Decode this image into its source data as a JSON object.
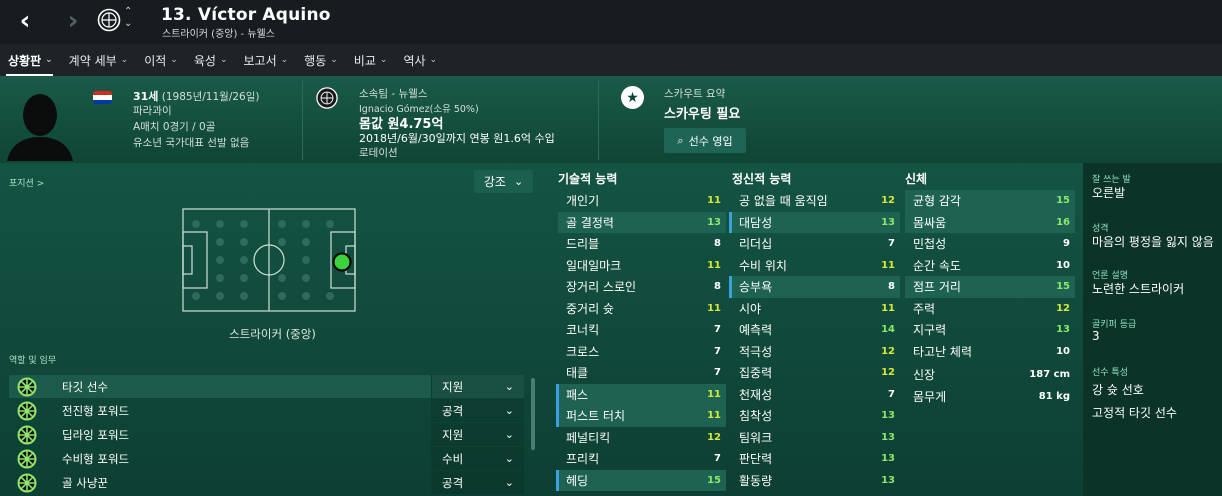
{
  "header": {
    "player_name": "13. Víctor Aquino",
    "player_subtitle": "스트라이커 (중앙) - 뉴웰스",
    "back_icon": "chevron-left-icon",
    "forward_icon": "chevron-right-icon"
  },
  "menu": [
    {
      "label": "상황판",
      "active": true
    },
    {
      "label": "계약 세부"
    },
    {
      "label": "이적"
    },
    {
      "label": "육성"
    },
    {
      "label": "보고서"
    },
    {
      "label": "행동"
    },
    {
      "label": "비교"
    },
    {
      "label": "역사"
    }
  ],
  "info": {
    "age": "31세",
    "dob": "(1985년/11월/26일)",
    "nationality": "파라과이",
    "caps": "A매치 0경기 / 0골",
    "youth": "유소년 국가대표 선발 없음",
    "club_label": "소속팀 - 뉴웰스",
    "owner": "Ignacio Gómez(소유 50%)",
    "value_label": "몸값 원4.75억",
    "contract": "2018년/6월/30일까지 연봉 원1.6억 수입",
    "rotation": "로테이션",
    "scout_label": "스카우트 요약",
    "scout_status": "스카우팅 필요",
    "scout_button": "선수 영입"
  },
  "position": {
    "section_label": "포지션 >",
    "emphasis_label": "강조",
    "pitch_label": "스트라이커 (중앙)"
  },
  "roles": {
    "section_label": "역할 및 임무",
    "items": [
      {
        "name": "타깃 선수",
        "duty": "지원"
      },
      {
        "name": "전진형 포워드",
        "duty": "공격"
      },
      {
        "name": "딥라잉 포워드",
        "duty": "지원"
      },
      {
        "name": "수비형 포워드",
        "duty": "수비"
      },
      {
        "name": "골 사냥꾼",
        "duty": "공격"
      }
    ]
  },
  "technical": {
    "title": "기술적 능력",
    "items": [
      {
        "name": "개인기",
        "value": "11"
      },
      {
        "name": "골 결정력",
        "value": "13"
      },
      {
        "name": "드리블",
        "value": "8"
      },
      {
        "name": "일대일마크",
        "value": "11"
      },
      {
        "name": "장거리 스로인",
        "value": "8"
      },
      {
        "name": "중거리 슛",
        "value": "11"
      },
      {
        "name": "코너킥",
        "value": "7"
      },
      {
        "name": "크로스",
        "value": "7"
      },
      {
        "name": "태클",
        "value": "7"
      },
      {
        "name": "패스",
        "value": "11"
      },
      {
        "name": "퍼스트 터치",
        "value": "11"
      },
      {
        "name": "페널티킥",
        "value": "12"
      },
      {
        "name": "프리킥",
        "value": "7"
      },
      {
        "name": "헤딩",
        "value": "15"
      }
    ]
  },
  "mental": {
    "title": "정신적 능력",
    "items": [
      {
        "name": "공 없을 때 움직임",
        "value": "12"
      },
      {
        "name": "대담성",
        "value": "13"
      },
      {
        "name": "리더십",
        "value": "7"
      },
      {
        "name": "수비 위치",
        "value": "11"
      },
      {
        "name": "승부욕",
        "value": "8"
      },
      {
        "name": "시야",
        "value": "11"
      },
      {
        "name": "예측력",
        "value": "14"
      },
      {
        "name": "적극성",
        "value": "12"
      },
      {
        "name": "집중력",
        "value": "12"
      },
      {
        "name": "천재성",
        "value": "7"
      },
      {
        "name": "침착성",
        "value": "13"
      },
      {
        "name": "팀워크",
        "value": "13"
      },
      {
        "name": "판단력",
        "value": "13"
      },
      {
        "name": "활동량",
        "value": "13"
      }
    ]
  },
  "physical": {
    "title": "신체",
    "items": [
      {
        "name": "균형 감각",
        "value": "15"
      },
      {
        "name": "몸싸움",
        "value": "16"
      },
      {
        "name": "민첩성",
        "value": "9"
      },
      {
        "name": "순간 속도",
        "value": "10"
      },
      {
        "name": "점프 거리",
        "value": "15"
      },
      {
        "name": "주력",
        "value": "12"
      },
      {
        "name": "지구력",
        "value": "13"
      },
      {
        "name": "타고난 체력",
        "value": "10"
      }
    ],
    "height_label": "신장",
    "height_value": "187 cm",
    "weight_label": "몸무게",
    "weight_value": "81 kg"
  },
  "side": {
    "foot_label": "잘 쓰는 발",
    "foot_value": "오른발",
    "personality_label": "성격",
    "personality_value": "마음의 평정을 잃지 않음",
    "media_label": "언론 설명",
    "media_value": "노련한 스트라이커",
    "gk_label": "골키퍼 등급",
    "gk_value": "3",
    "traits_label": "선수 특성",
    "traits": [
      "강 슛 선호",
      "고정적 타깃 선수"
    ]
  },
  "colors": {
    "value_green": "#8ee66b",
    "value_yellow": "#d4ea3a",
    "pitch_marker": "#3bd23b"
  }
}
